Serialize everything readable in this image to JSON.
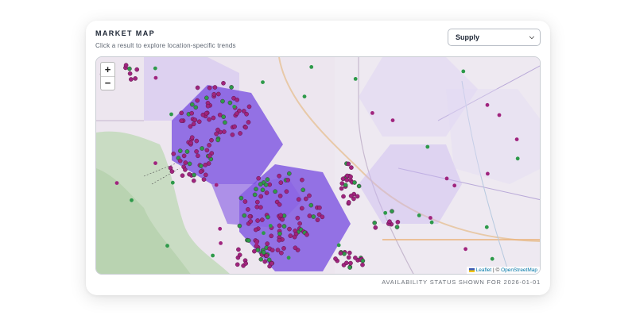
{
  "panel": {
    "title": "MARKET MAP",
    "subtitle": "Click a result to explore location-specific trends"
  },
  "metric_select": {
    "selected": "Supply"
  },
  "map": {
    "zoom_in": "+",
    "zoom_out": "−",
    "attribution_leaflet": "Leaflet",
    "attribution_sep": " | © ",
    "attribution_osm": "OpenStreetMap"
  },
  "footer": {
    "status": "AVAILABILITY STATUS SHOWN FOR 2026-01-01"
  },
  "colors": {
    "hex_fill_strong": "#7a4fe0",
    "hex_fill_light": "#c9b9f2",
    "marker_magenta": "#a0247e",
    "marker_green": "#2e9a4a"
  },
  "icons": {
    "select": "chevron-down-icon",
    "attribution": "ukraine-flag-icon"
  }
}
